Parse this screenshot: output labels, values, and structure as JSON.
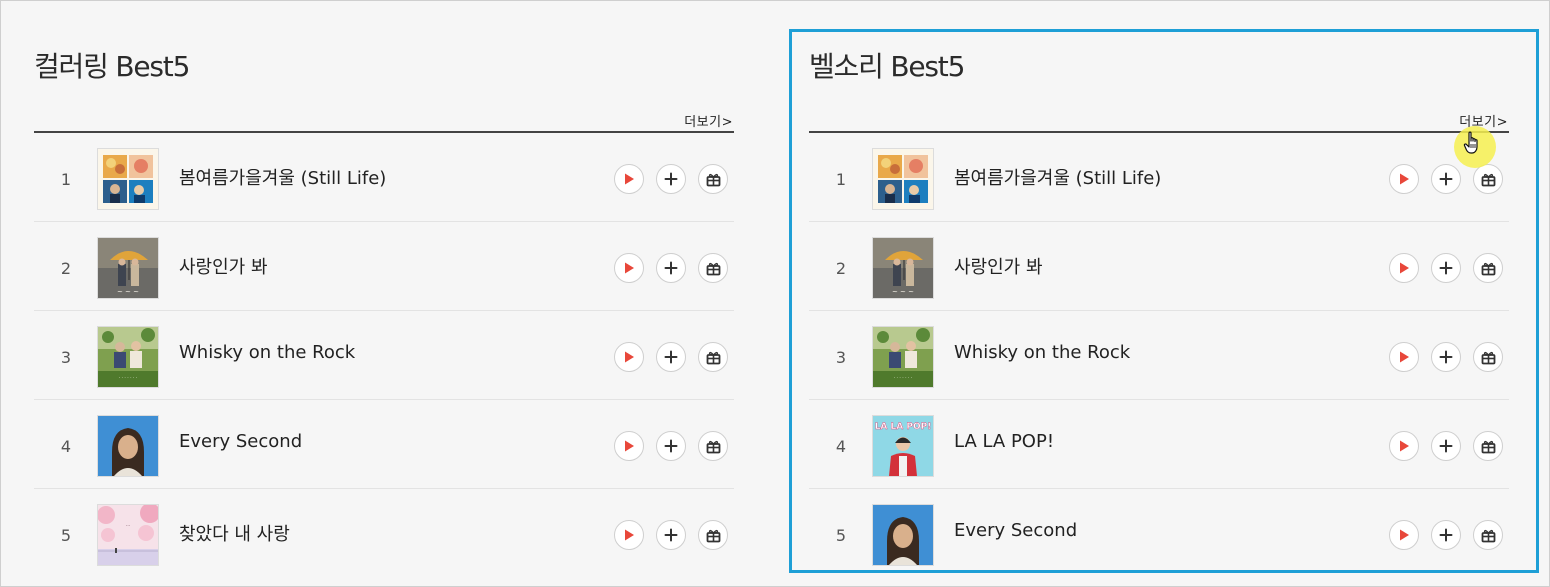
{
  "panels": [
    {
      "title": "컬러링 Best5",
      "more": "더보기>",
      "items": [
        {
          "rank": "1",
          "title": "봄여름가을겨울 (Still Life)",
          "cover": "four-seasons"
        },
        {
          "rank": "2",
          "title": "사랑인가 봐",
          "cover": "umbrella-rain"
        },
        {
          "rank": "3",
          "title": "Whisky on the Rock",
          "cover": "garden-couple"
        },
        {
          "rank": "4",
          "title": "Every Second",
          "cover": "woman-blue"
        },
        {
          "rank": "5",
          "title": "찾았다 내 사랑",
          "cover": "cherry-blossom"
        }
      ]
    },
    {
      "title": "벨소리 Best5",
      "more": "더보기>",
      "items": [
        {
          "rank": "1",
          "title": "봄여름가을겨울 (Still Life)",
          "cover": "four-seasons"
        },
        {
          "rank": "2",
          "title": "사랑인가 봐",
          "cover": "umbrella-rain"
        },
        {
          "rank": "3",
          "title": "Whisky on the Rock",
          "cover": "garden-couple"
        },
        {
          "rank": "4",
          "title": "LA LA POP!",
          "cover": "lalapop"
        },
        {
          "rank": "5",
          "title": "Every Second",
          "cover": "woman-blue"
        }
      ]
    }
  ],
  "cover_art_text": {
    "lalapop": "LA LA POP!"
  },
  "buttons": {
    "play_icon": "play-icon",
    "add_icon": "plus-icon",
    "gift_icon": "gift-icon"
  },
  "colors": {
    "play": "#e8473a",
    "highlight_frame": "#1e9fd6",
    "cursor_halo": "#f6f050"
  }
}
